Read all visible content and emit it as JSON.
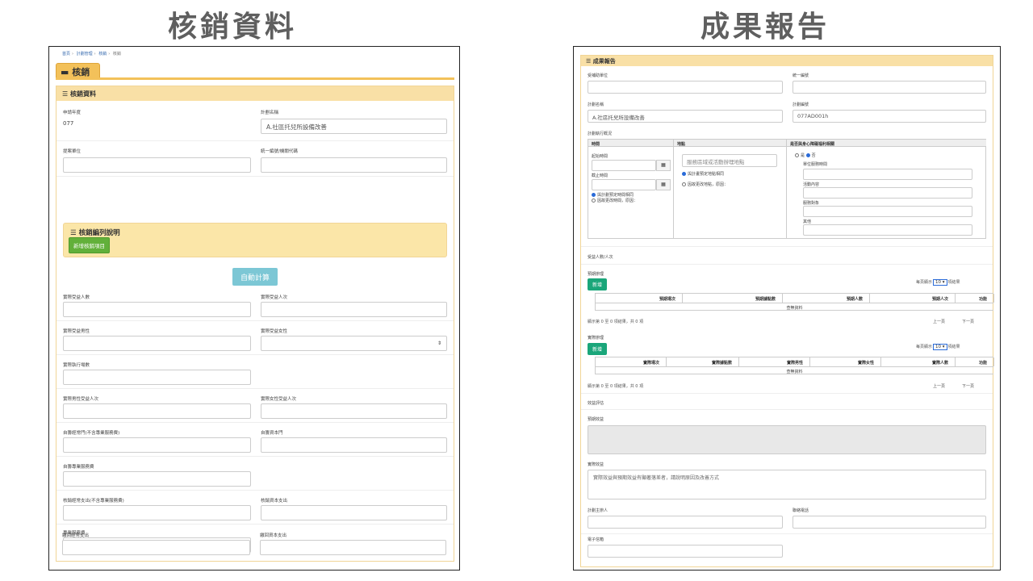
{
  "titles": {
    "left": "核銷資料",
    "right": "成果報告"
  },
  "left": {
    "breadcrumb": [
      "首頁",
      "計劃管理",
      "核銷",
      "核銷"
    ],
    "tab_label": "核銷",
    "panel_title": "核銷資料",
    "apply_year_label": "申請年度",
    "apply_year_value": "077",
    "plan_name_label": "計劃名稱",
    "plan_name_value": "A.社區托兒所設備改善",
    "proposer_label": "提案單位",
    "tax_id_label": "統一編號/機關代碼",
    "note_title": "核銷編列說明",
    "add_item_button": "新增核銷項目",
    "auto_calc_button": "自動計算",
    "fields": [
      [
        "實際受益人數",
        "實際受益人次"
      ],
      [
        "實際受益男性",
        "實際受益女性"
      ],
      [
        "實際執行場數",
        ""
      ],
      [
        "實際男性受益人次",
        "實際女性受益人次"
      ],
      [
        "自籌經常門(不含專業服務費)",
        "自籌資本門"
      ],
      [
        "自籌專業服務費",
        ""
      ],
      [
        "核銷經常支出(不含專業服務費)",
        "核銷資本支出"
      ],
      [
        "專業服務費",
        ""
      ],
      [
        "繳回經常支出",
        "繳回資本支出"
      ]
    ]
  },
  "right": {
    "panel_title": "成果報告",
    "grantee_label": "受補助單位",
    "tax_id_label": "統一編號",
    "plan_name_label": "計劃名稱",
    "plan_name_value": "A.社區托兒所設備改善",
    "plan_no_label": "計劃編號",
    "plan_no_value": "077AD001h",
    "exec_overview_label": "計劃執行概況",
    "col_time": "時間",
    "col_place": "地點",
    "col_disability": "是否與身心障礙福利相關",
    "start_label": "起始時間",
    "end_label": "截止時間",
    "place_placeholder": "服務區域或活動辦理地點",
    "time_same": "與計劃預定時間相同",
    "time_changed": "因故更改時間，原因：",
    "place_same": "與計畫預定地點相同",
    "place_changed": "因故更改地點，原因：",
    "yes": "是",
    "no": "否",
    "unit_hours": "單位服務時間",
    "activity": "活動內容",
    "target": "服務對象",
    "other": "其他",
    "beneficiaries_label": "受益人數/人次",
    "planned_label": "預期辦理",
    "add_button": "新增",
    "per_page_prefix": "每頁顯示",
    "per_page_value": "10",
    "per_page_suffix": "項結果",
    "planned_headers": [
      "預期場次",
      "預期據點數",
      "預期人數",
      "預期人次",
      "功能"
    ],
    "empty_text": "查無資料",
    "showing_text": "顯示第 0 至 0 項結果，共 0 項",
    "prev": "上一頁",
    "next": "下一頁",
    "actual_label": "實際辦理",
    "actual_headers": [
      "實際場次",
      "實際據點數",
      "實際男性",
      "實際女性",
      "實際人數",
      "功能"
    ],
    "eval_label": "效益評估",
    "expected_benefit_label": "預期效益",
    "actual_benefit_label": "實際效益",
    "actual_benefit_placeholder": "實際效益與預期效益有顯著落差者，請說明原因及改善方式",
    "contact_label": "計劃主辦人",
    "phone_label": "聯絡電話",
    "email_label": "電子信箱"
  }
}
